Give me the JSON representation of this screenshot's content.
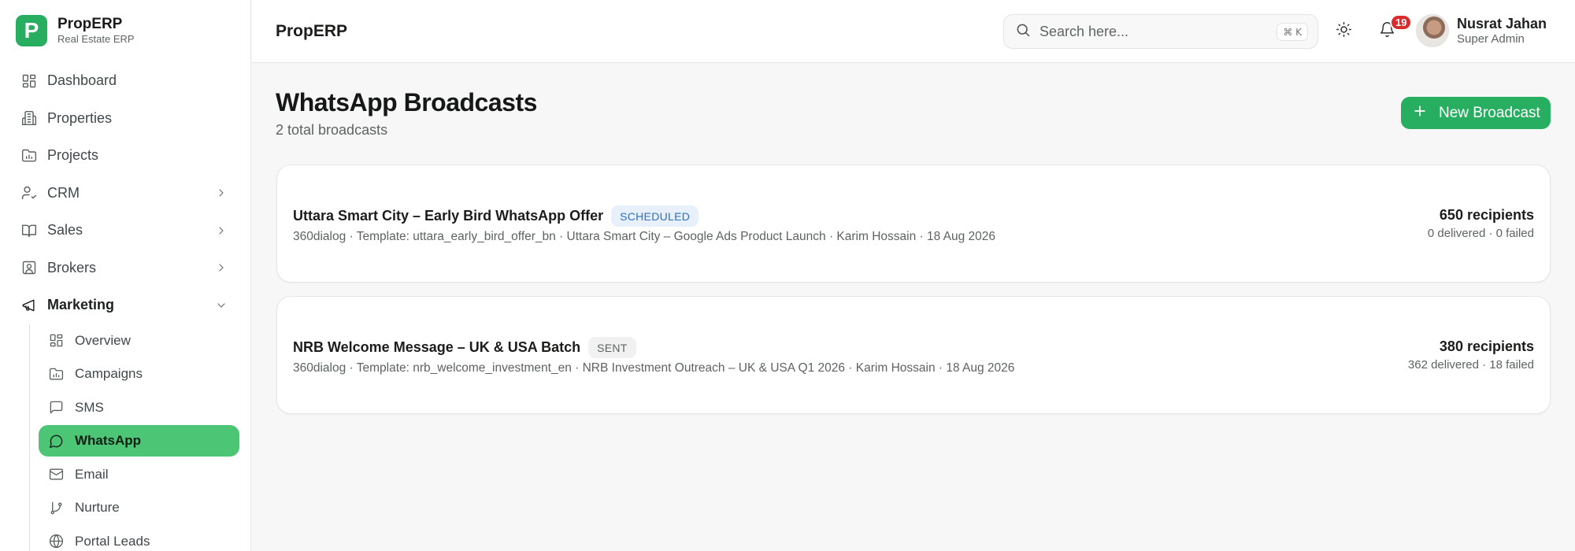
{
  "brand": {
    "logo_letter": "P",
    "name": "PropERP",
    "subtitle": "Real Estate ERP",
    "color": "#27ae60"
  },
  "sidebar": {
    "items": [
      {
        "label": "Dashboard",
        "icon": "dashboard-icon"
      },
      {
        "label": "Properties",
        "icon": "building-icon"
      },
      {
        "label": "Projects",
        "icon": "folder-chart-icon"
      },
      {
        "label": "CRM",
        "icon": "user-check-icon",
        "expandable": true
      },
      {
        "label": "Sales",
        "icon": "book-open-icon",
        "expandable": true
      },
      {
        "label": "Brokers",
        "icon": "contact-icon",
        "expandable": true
      },
      {
        "label": "Marketing",
        "icon": "megaphone-icon",
        "expanded": true
      }
    ],
    "marketing_sub": [
      {
        "label": "Overview",
        "icon": "dashboard-icon"
      },
      {
        "label": "Campaigns",
        "icon": "folder-chart-icon"
      },
      {
        "label": "SMS",
        "icon": "message-square-icon"
      },
      {
        "label": "WhatsApp",
        "icon": "message-circle-icon",
        "active": true
      },
      {
        "label": "Email",
        "icon": "mail-icon"
      },
      {
        "label": "Nurture",
        "icon": "git-branch-icon"
      },
      {
        "label": "Portal Leads",
        "icon": "globe-icon"
      }
    ]
  },
  "header": {
    "title": "PropERP",
    "search_placeholder": "Search here...",
    "search_shortcut": "⌘ K",
    "notifications_count": "19",
    "user": {
      "name": "Nusrat Jahan",
      "role": "Super Admin"
    }
  },
  "page": {
    "title": "WhatsApp Broadcasts",
    "subtitle": "2 total broadcasts",
    "new_button_label": "New Broadcast"
  },
  "broadcasts": [
    {
      "title": "Uttara Smart City – Early Bird WhatsApp Offer",
      "status": "SCHEDULED",
      "meta": "360dialog · Template: uttara_early_bird_offer_bn · Uttara Smart City – Google Ads Product Launch · Karim Hossain · 18 Aug 2026",
      "recipients": "650 recipients",
      "delivery": "0 delivered · 0 failed"
    },
    {
      "title": "NRB Welcome Message – UK & USA Batch",
      "status": "SENT",
      "meta": "360dialog · Template: nrb_welcome_investment_en · NRB Investment Outreach – UK & USA Q1 2026 · Karim Hossain · 18 Aug 2026",
      "recipients": "380 recipients",
      "delivery": "362 delivered · 18 failed"
    }
  ],
  "colors": {
    "accent": "#27ae60",
    "active_nav": "#4cc575",
    "badge": "#d92d2d",
    "scheduled": "#2f6fbe"
  }
}
